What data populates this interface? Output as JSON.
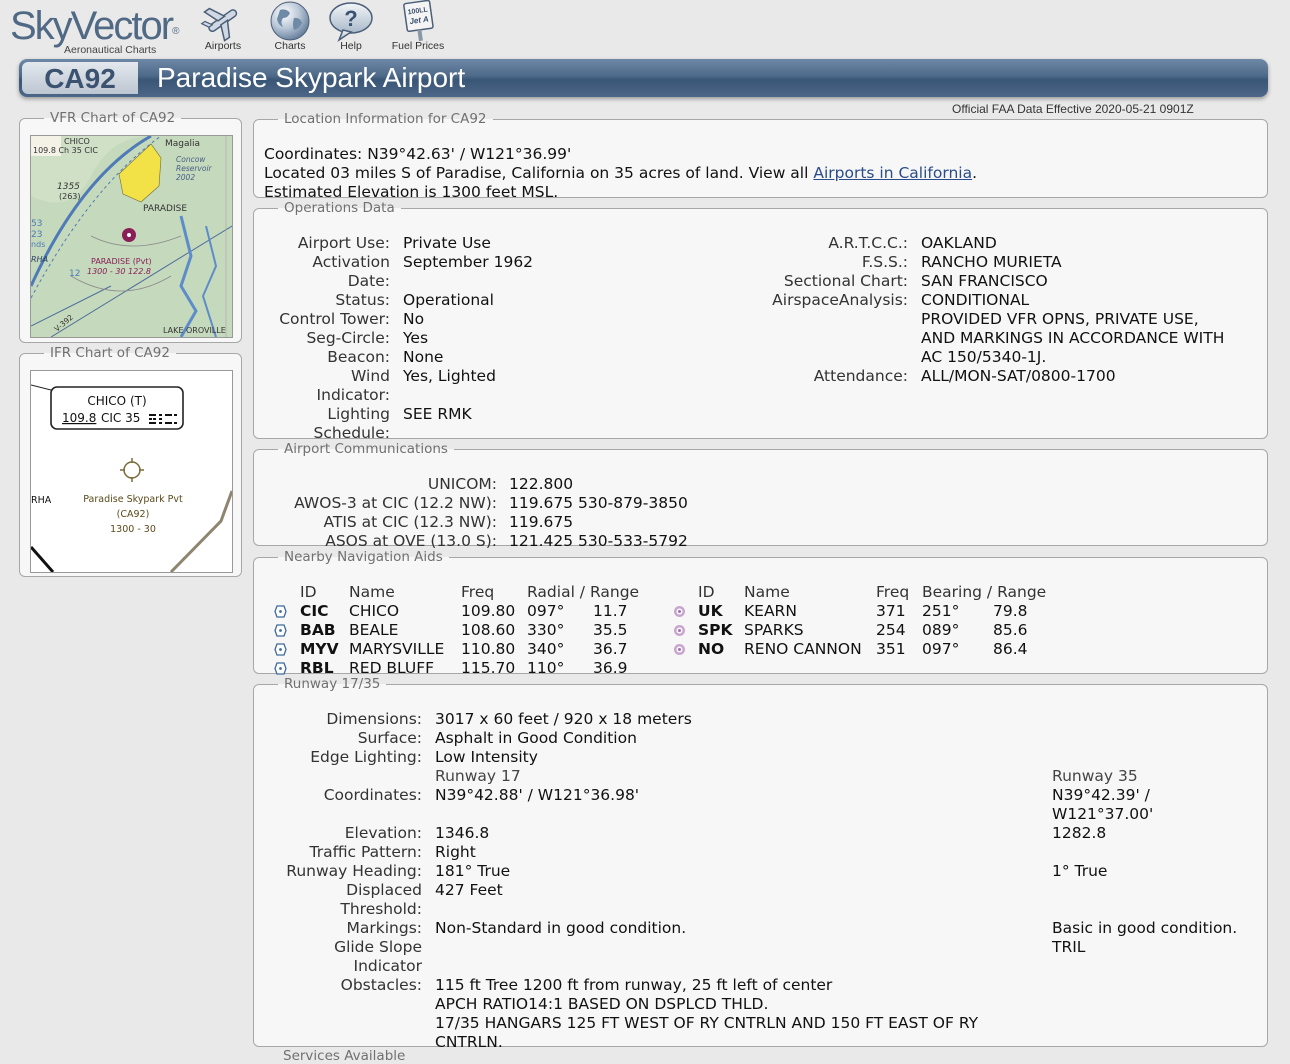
{
  "header": {
    "logo_main": "SkyVector",
    "logo_sub": "Aeronautical Charts",
    "nav": [
      {
        "label": "Airports",
        "icon": "airplane-icon"
      },
      {
        "label": "Charts",
        "icon": "globe-icon"
      },
      {
        "label": "Help",
        "icon": "help-bubble-icon"
      },
      {
        "label": "Fuel Prices",
        "icon": "fuel-sign-icon"
      }
    ],
    "fuel_sign_text_1": "100LL",
    "fuel_sign_text_2": "Jet A"
  },
  "airport": {
    "ident": "CA92",
    "name": "Paradise Skypark Airport",
    "effective": "Official FAA Data Effective 2020-05-21 0901Z"
  },
  "vfr": {
    "legend": "VFR Chart of CA92",
    "labels": {
      "chico": "CHICO",
      "freq": "109.8 Ch 35 CIC",
      "magalia": "Magalia",
      "concow1": "Concow",
      "concow2": "Reservoir",
      "concow3": "2002",
      "elev": "1355",
      "elev_paren": "(263)",
      "paradise": "PARADISE",
      "rha": "RHA",
      "apt1": "PARADISE (Pvt)",
      "apt2": "1300 - 30 122.8",
      "lake": "LAKE OROVILLE",
      "v": "V-392",
      "n53": "53",
      "n23": "23",
      "nds": "nds",
      "n12": "12"
    }
  },
  "ifr": {
    "legend": "IFR Chart of CA92",
    "box_line1": "CHICO (T)",
    "box_freq": "109.8",
    "box_rest": "CIC 35",
    "apt_name": "Paradise Skypark Pvt",
    "apt_id": "(CA92)",
    "apt_elev": "1300 - 30",
    "rha": "RHA"
  },
  "location": {
    "legend": "Location Information for CA92",
    "coords": "Coordinates: N39°42.63' / W121°36.99'",
    "located_prefix": "Located 03 miles S of Paradise, California on 35 acres of land. View all ",
    "located_link": "Airports in California",
    "located_suffix": ".",
    "elevation": "Estimated Elevation is 1300 feet MSL."
  },
  "operations": {
    "legend": "Operations Data",
    "left": {
      "use_l": "Airport Use:",
      "use_v": "Private Use",
      "act_l1": "Activation",
      "act_l2": "Date:",
      "act_v": "September 1962",
      "status_l": "Status:",
      "status_v": "Operational",
      "tower_l": "Control Tower:",
      "tower_v": "No",
      "seg_l": "Seg-Circle:",
      "seg_v": "Yes",
      "beacon_l": "Beacon:",
      "beacon_v": "None",
      "wind_l1": "Wind",
      "wind_l2": "Indicator:",
      "wind_v": "Yes, Lighted",
      "light_l1": "Lighting",
      "light_l2": "Schedule:",
      "light_v": "SEE RMK"
    },
    "right": {
      "artcc_l": "A.R.T.C.C.:",
      "artcc_v": "OAKLAND",
      "fss_l": "F.S.S.:",
      "fss_v": "RANCHO MURIETA",
      "sect_l": "Sectional Chart:",
      "sect_v": "SAN FRANCISCO",
      "air_l": "AirspaceAnalysis:",
      "air_v1": "CONDITIONAL",
      "air_v2": "PROVIDED VFR OPNS, PRIVATE USE,",
      "air_v3": "AND MARKINGS IN ACCORDANCE WITH",
      "air_v4": "AC 150/5340-1J.",
      "att_l": "Attendance:",
      "att_v": "ALL/MON-SAT/0800-1700"
    }
  },
  "comms": {
    "legend": "Airport Communications",
    "rows": [
      {
        "label": "UNICOM:",
        "value": "122.800"
      },
      {
        "label": "AWOS-3 at CIC (12.2 NW):",
        "value": "119.675 530-879-3850"
      },
      {
        "label": "ATIS at CIC (12.3 NW):",
        "value": "119.675"
      },
      {
        "label": "ASOS at OVE (13.0 S):",
        "value": "121.425 530-533-5792"
      }
    ]
  },
  "navaids": {
    "legend": "Nearby Navigation Aids",
    "headers": {
      "id": "ID",
      "name": "Name",
      "freq": "Freq",
      "radial": "Radial / Range",
      "bearing": "Bearing / Range"
    },
    "vor": [
      {
        "id": "CIC",
        "name": "CHICO",
        "freq": "109.80",
        "radial": "097°",
        "range": "11.7"
      },
      {
        "id": "BAB",
        "name": "BEALE",
        "freq": "108.60",
        "radial": "330°",
        "range": "35.5"
      },
      {
        "id": "MYV",
        "name": "MARYSVILLE",
        "freq": "110.80",
        "radial": "340°",
        "range": "36.7"
      },
      {
        "id": "RBL",
        "name": "RED BLUFF",
        "freq": "115.70",
        "radial": "110°",
        "range": "36.9"
      }
    ],
    "ndb": [
      {
        "id": "UK",
        "name": "KEARN",
        "freq": "371",
        "bearing": "251°",
        "range": "79.8"
      },
      {
        "id": "SPK",
        "name": "SPARKS",
        "freq": "254",
        "bearing": "089°",
        "range": "85.6"
      },
      {
        "id": "NO",
        "name": "RENO CANNON",
        "freq": "351",
        "bearing": "097°",
        "range": "86.4"
      }
    ]
  },
  "runway": {
    "legend": "Runway 17/35",
    "dim_l": "Dimensions:",
    "dim_v": "3017 x 60 feet / 920 x 18 meters",
    "surf_l": "Surface:",
    "surf_v": "Asphalt in Good Condition",
    "edge_l": "Edge Lighting:",
    "edge_v": "Low Intensity",
    "rwy_a": "Runway 17",
    "rwy_b": "Runway 35",
    "coord_l": "Coordinates:",
    "coord_a": "N39°42.88' / W121°36.98'",
    "coord_b1": "N39°42.39' /",
    "coord_b2": "W121°37.00'",
    "elev_l": "Elevation:",
    "elev_a": "1346.8",
    "elev_b": "1282.8",
    "traffic_l": "Traffic Pattern:",
    "traffic_a": "Right",
    "heading_l": "Runway Heading:",
    "heading_a": "181° True",
    "heading_b": "1° True",
    "disp_l1": "Displaced",
    "disp_l2": "Threshold:",
    "disp_a": "427 Feet",
    "mark_l": "Markings:",
    "mark_a": "Non-Standard in good condition.",
    "mark_b": "Basic in good condition.",
    "glide_l1": "Glide Slope",
    "glide_l2": "Indicator",
    "glide_b": "TRIL",
    "obst_l": "Obstacles:",
    "obst_1": "115 ft Tree 1200 ft from runway, 25 ft left of center",
    "obst_2": "APCH RATIO14:1 BASED ON DSPLCD THLD.",
    "obst_3": "17/35 HANGARS 125 FT WEST OF RY CNTRLN AND 150 FT EAST OF RY",
    "obst_4": "CNTRLN."
  },
  "services_legend": "Services Available"
}
